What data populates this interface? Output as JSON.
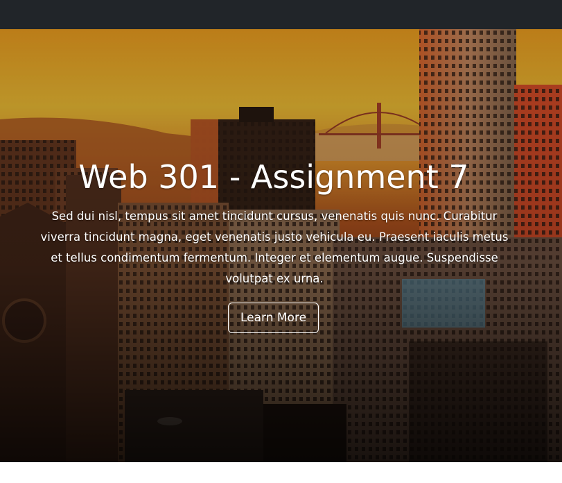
{
  "hero": {
    "title": "Web 301 - Assignment 7",
    "text": "Sed dui nisl, tempus sit amet tincidunt cursus, venenatis quis nunc. Curabitur viverra tincidunt magna, eget venenatis justo vehicula eu. Praesent iaculis metus et tellus condimentum fermentum. Integer et elementum augue. Suspendisse volutpat ex urna.",
    "button_label": "Learn More",
    "background_image": "city-skyline-sunset-photo"
  },
  "colors": {
    "navbar": "#212529",
    "hero_text": "#ffffff",
    "sky_top": "#f2a21e",
    "sky_glow": "#ffd24a"
  }
}
